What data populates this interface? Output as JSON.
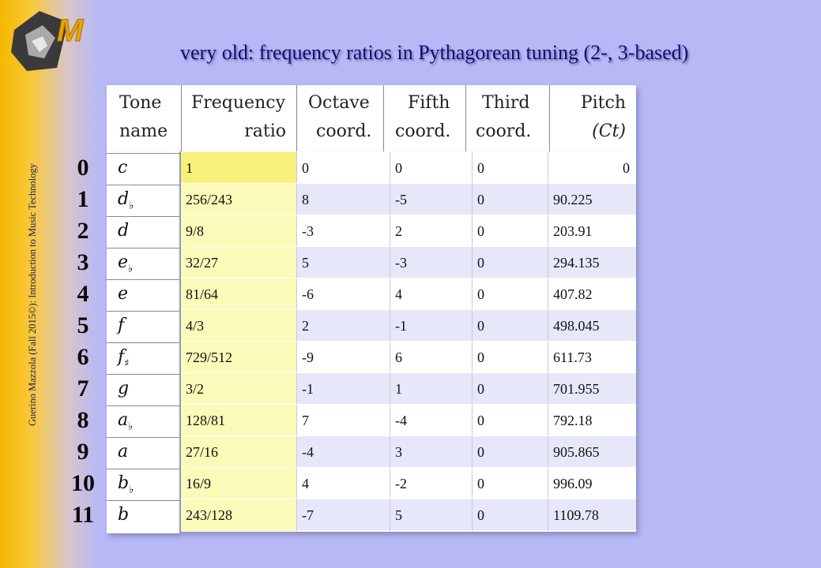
{
  "title": "very old: frequency ratios in Pythagorean tuning (2-, 3-based)",
  "side_text": "Guerino Mazzola (Fall 2015©): Introduction to Music Technology",
  "logo_letter": "M",
  "headers": [
    {
      "l1": "Tone",
      "l2": "name"
    },
    {
      "l1": "Frequency",
      "l2": "ratio"
    },
    {
      "l1": "Octave",
      "l2": "coord."
    },
    {
      "l1": "Fifth",
      "l2": "coord."
    },
    {
      "l1": "Third",
      "l2": "coord."
    },
    {
      "l1": "Pitch",
      "l2": "(Ct)"
    }
  ],
  "rows": [
    {
      "idx": "0",
      "base": "c",
      "acc": "",
      "ratio": "1",
      "oct": "0",
      "fifth": "0",
      "third": "0",
      "pitch": "0"
    },
    {
      "idx": "1",
      "base": "d",
      "acc": "♭",
      "ratio": "256/243",
      "oct": "8",
      "fifth": "-5",
      "third": "0",
      "pitch": "90.225"
    },
    {
      "idx": "2",
      "base": "d",
      "acc": "",
      "ratio": "9/8",
      "oct": "-3",
      "fifth": "2",
      "third": "0",
      "pitch": "203.91"
    },
    {
      "idx": "3",
      "base": "e",
      "acc": "♭",
      "ratio": "32/27",
      "oct": "5",
      "fifth": "-3",
      "third": "0",
      "pitch": "294.135"
    },
    {
      "idx": "4",
      "base": "e",
      "acc": "",
      "ratio": "81/64",
      "oct": "-6",
      "fifth": "4",
      "third": "0",
      "pitch": "407.82"
    },
    {
      "idx": "5",
      "base": "f",
      "acc": "",
      "ratio": "4/3",
      "oct": "2",
      "fifth": "-1",
      "third": "0",
      "pitch": "498.045"
    },
    {
      "idx": "6",
      "base": "f",
      "acc": "♯",
      "ratio": "729/512",
      "oct": "-9",
      "fifth": "6",
      "third": "0",
      "pitch": "611.73"
    },
    {
      "idx": "7",
      "base": "g",
      "acc": "",
      "ratio": "3/2",
      "oct": "-1",
      "fifth": "1",
      "third": "0",
      "pitch": "701.955"
    },
    {
      "idx": "8",
      "base": "a",
      "acc": "♭",
      "ratio": "128/81",
      "oct": "7",
      "fifth": "-4",
      "third": "0",
      "pitch": "792.18"
    },
    {
      "idx": "9",
      "base": "a",
      "acc": "",
      "ratio": "27/16",
      "oct": "-4",
      "fifth": "3",
      "third": "0",
      "pitch": "905.865"
    },
    {
      "idx": "10",
      "base": "b",
      "acc": "♭",
      "ratio": "16/9",
      "oct": "4",
      "fifth": "-2",
      "third": "0",
      "pitch": "996.09"
    },
    {
      "idx": "11",
      "base": "b",
      "acc": "",
      "ratio": "243/128",
      "oct": "-7",
      "fifth": "5",
      "third": "0",
      "pitch": "1109.78"
    }
  ]
}
